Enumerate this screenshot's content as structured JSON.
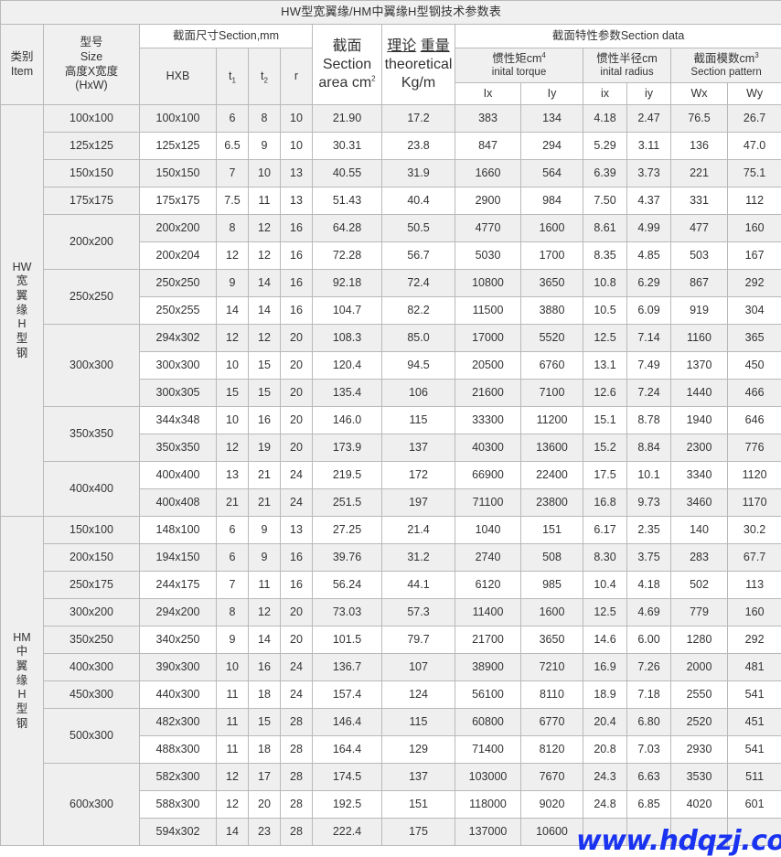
{
  "title": "HW型宽翼缘/HM中翼缘H型钢技术参数表",
  "watermark": "www.hdqzj.com",
  "colors": {
    "accent_red": "#ff0000",
    "watermark_blue": "#1a33f0",
    "header_bg": "#f0f0f0",
    "row_shade": "#efefef",
    "border": "#b9b9b9"
  },
  "header": {
    "category": {
      "cn": "类别",
      "en": "Item"
    },
    "size": {
      "l1": "型号",
      "l2": "Size",
      "l3": "高度X宽度",
      "l4": "(HxW)"
    },
    "section_dims": "截面尺寸Section,mm",
    "hxb": "HXB",
    "t1": "t",
    "t1_sub": "1",
    "t2": "t",
    "t2_sub": "2",
    "r": "r",
    "section_area": {
      "l1": "截面",
      "l2": "Section",
      "l3": "area",
      "l4": "cm",
      "sup": "2"
    },
    "theoretical_weight": {
      "l1": "理论",
      "l2": "重量",
      "l3": "theoretical",
      "l4": "Kg/m"
    },
    "section_data": "截面特性参数Section data",
    "inertia": {
      "cn": "惯性矩cm",
      "sup": "4",
      "en": "inital torque"
    },
    "radius": {
      "cn": "惯性半径cm",
      "en": "inital radius"
    },
    "modulus": {
      "cn": "截面模数cm",
      "sup": "3",
      "en": "Section pattern"
    },
    "Ix": "Ix",
    "Iy": "Iy",
    "ix": "ix",
    "iy": "iy",
    "Wx": "Wx",
    "Wy": "Wy"
  },
  "categories": [
    {
      "code": "HW",
      "label_chars": [
        "HW",
        "宽",
        "翼",
        "缘",
        "H",
        "型",
        "钢"
      ],
      "groups": [
        {
          "size": "100x100",
          "rows": [
            {
              "hxb": "100x100",
              "t1": "6",
              "t2": "8",
              "r": "10",
              "area": "21.90",
              "weight": "17.2",
              "Ix": "383",
              "Iy": "134",
              "ix": "4.18",
              "iy": "2.47",
              "Wx": "76.5",
              "Wy": "26.7"
            }
          ]
        },
        {
          "size": "125x125",
          "rows": [
            {
              "hxb": "125x125",
              "t1": "6.5",
              "t2": "9",
              "r": "10",
              "area": "30.31",
              "weight": "23.8",
              "Ix": "847",
              "Iy": "294",
              "ix": "5.29",
              "iy": "3.11",
              "Wx": "136",
              "Wy": "47.0"
            }
          ]
        },
        {
          "size": "150x150",
          "rows": [
            {
              "hxb": "150x150",
              "t1": "7",
              "t2": "10",
              "r": "13",
              "area": "40.55",
              "weight": "31.9",
              "Ix": "1660",
              "Iy": "564",
              "ix": "6.39",
              "iy": "3.73",
              "Wx": "221",
              "Wy": "75.1"
            }
          ]
        },
        {
          "size": "175x175",
          "rows": [
            {
              "hxb": "175x175",
              "t1": "7.5",
              "t2": "11",
              "r": "13",
              "area": "51.43",
              "weight": "40.4",
              "Ix": "2900",
              "Iy": "984",
              "ix": "7.50",
              "iy": "4.37",
              "Wx": "331",
              "Wy": "112"
            }
          ]
        },
        {
          "size": "200x200",
          "rows": [
            {
              "hxb": "200x200",
              "t1": "8",
              "t2": "12",
              "r": "16",
              "area": "64.28",
              "weight": "50.5",
              "Ix": "4770",
              "Iy": "1600",
              "ix": "8.61",
              "iy": "4.99",
              "Wx": "477",
              "Wy": "160"
            },
            {
              "hxb": "200x204",
              "t1": "12",
              "t2": "12",
              "r": "16",
              "area": "72.28",
              "weight": "56.7",
              "Ix": "5030",
              "Iy": "1700",
              "ix": "8.35",
              "iy": "4.85",
              "Wx": "503",
              "Wy": "167"
            }
          ]
        },
        {
          "size": "250x250",
          "rows": [
            {
              "hxb": "250x250",
              "t1": "9",
              "t2": "14",
              "r": "16",
              "area": "92.18",
              "weight": "72.4",
              "Ix": "10800",
              "Iy": "3650",
              "ix": "10.8",
              "iy": "6.29",
              "Wx": "867",
              "Wy": "292"
            },
            {
              "hxb": "250x255",
              "t1": "14",
              "t2": "14",
              "r": "16",
              "area": "104.7",
              "weight": "82.2",
              "Ix": "11500",
              "Iy": "3880",
              "ix": "10.5",
              "iy": "6.09",
              "Wx": "919",
              "Wy": "304"
            }
          ]
        },
        {
          "size": "300x300",
          "rows": [
            {
              "hxb": "294x302",
              "t1": "12",
              "t2": "12",
              "r": "20",
              "area": "108.3",
              "weight": "85.0",
              "Ix": "17000",
              "Iy": "5520",
              "ix": "12.5",
              "iy": "7.14",
              "Wx": "1160",
              "Wy": "365"
            },
            {
              "hxb": "300x300",
              "t1": "10",
              "t2": "15",
              "r": "20",
              "area": "120.4",
              "weight": "94.5",
              "Ix": "20500",
              "Iy": "6760",
              "ix": "13.1",
              "iy": "7.49",
              "Wx": "1370",
              "Wy": "450"
            },
            {
              "hxb": "300x305",
              "t1": "15",
              "t2": "15",
              "r": "20",
              "area": "135.4",
              "weight": "106",
              "Ix": "21600",
              "Iy": "7100",
              "ix": "12.6",
              "iy": "7.24",
              "Wx": "1440",
              "Wy": "466"
            }
          ]
        },
        {
          "size": "350x350",
          "rows": [
            {
              "hxb": "344x348",
              "t1": "10",
              "t2": "16",
              "r": "20",
              "area": "146.0",
              "weight": "115",
              "Ix": "33300",
              "Iy": "11200",
              "ix": "15.1",
              "iy": "8.78",
              "Wx": "1940",
              "Wy": "646"
            },
            {
              "hxb": "350x350",
              "t1": "12",
              "t2": "19",
              "r": "20",
              "area": "173.9",
              "weight": "137",
              "Ix": "40300",
              "Iy": "13600",
              "ix": "15.2",
              "iy": "8.84",
              "Wx": "2300",
              "Wy": "776"
            }
          ]
        },
        {
          "size": "400x400",
          "rows": [
            {
              "hxb": "400x400",
              "t1": "13",
              "t2": "21",
              "r": "24",
              "area": "219.5",
              "weight": "172",
              "Ix": "66900",
              "Iy": "22400",
              "ix": "17.5",
              "iy": "10.1",
              "Wx": "3340",
              "Wy": "1120"
            },
            {
              "hxb": "400x408",
              "t1": "21",
              "t2": "21",
              "r": "24",
              "area": "251.5",
              "weight": "197",
              "Ix": "71100",
              "Iy": "23800",
              "ix": "16.8",
              "iy": "9.73",
              "Wx": "3460",
              "Wy": "1170"
            }
          ]
        }
      ]
    },
    {
      "code": "HM",
      "label_chars": [
        "HM",
        "中",
        "翼",
        "缘",
        "H",
        "型",
        "钢"
      ],
      "groups": [
        {
          "size": "150x100",
          "rows": [
            {
              "hxb": "148x100",
              "t1": "6",
              "t2": "9",
              "r": "13",
              "area": "27.25",
              "weight": "21.4",
              "Ix": "1040",
              "Iy": "151",
              "ix": "6.17",
              "iy": "2.35",
              "Wx": "140",
              "Wy": "30.2"
            }
          ]
        },
        {
          "size": "200x150",
          "rows": [
            {
              "hxb": "194x150",
              "t1": "6",
              "t2": "9",
              "r": "16",
              "area": "39.76",
              "weight": "31.2",
              "Ix": "2740",
              "Iy": "508",
              "ix": "8.30",
              "iy": "3.75",
              "Wx": "283",
              "Wy": "67.7"
            }
          ]
        },
        {
          "size": "250x175",
          "rows": [
            {
              "hxb": "244x175",
              "t1": "7",
              "t2": "11",
              "r": "16",
              "area": "56.24",
              "weight": "44.1",
              "Ix": "6120",
              "Iy": "985",
              "ix": "10.4",
              "iy": "4.18",
              "Wx": "502",
              "Wy": "113"
            }
          ]
        },
        {
          "size": "300x200",
          "rows": [
            {
              "hxb": "294x200",
              "t1": "8",
              "t2": "12",
              "r": "20",
              "area": "73.03",
              "weight": "57.3",
              "Ix": "11400",
              "Iy": "1600",
              "ix": "12.5",
              "iy": "4.69",
              "Wx": "779",
              "Wy": "160"
            }
          ]
        },
        {
          "size": "350x250",
          "rows": [
            {
              "hxb": "340x250",
              "t1": "9",
              "t2": "14",
              "r": "20",
              "area": "101.5",
              "weight": "79.7",
              "Ix": "21700",
              "Iy": "3650",
              "ix": "14.6",
              "iy": "6.00",
              "Wx": "1280",
              "Wy": "292"
            }
          ]
        },
        {
          "size": "400x300",
          "rows": [
            {
              "hxb": "390x300",
              "t1": "10",
              "t2": "16",
              "r": "24",
              "area": "136.7",
              "weight": "107",
              "Ix": "38900",
              "Iy": "7210",
              "ix": "16.9",
              "iy": "7.26",
              "Wx": "2000",
              "Wy": "481"
            }
          ]
        },
        {
          "size": "450x300",
          "rows": [
            {
              "hxb": "440x300",
              "t1": "11",
              "t2": "18",
              "r": "24",
              "area": "157.4",
              "weight": "124",
              "Ix": "56100",
              "Iy": "8110",
              "ix": "18.9",
              "iy": "7.18",
              "Wx": "2550",
              "Wy": "541"
            }
          ]
        },
        {
          "size": "500x300",
          "rows": [
            {
              "hxb": "482x300",
              "t1": "11",
              "t2": "15",
              "r": "28",
              "area": "146.4",
              "weight": "115",
              "Ix": "60800",
              "Iy": "6770",
              "ix": "20.4",
              "iy": "6.80",
              "Wx": "2520",
              "Wy": "451"
            },
            {
              "hxb": "488x300",
              "t1": "11",
              "t2": "18",
              "r": "28",
              "area": "164.4",
              "weight": "129",
              "Ix": "71400",
              "Iy": "8120",
              "ix": "20.8",
              "iy": "7.03",
              "Wx": "2930",
              "Wy": "541"
            }
          ]
        },
        {
          "size": "600x300",
          "rows": [
            {
              "hxb": "582x300",
              "t1": "12",
              "t2": "17",
              "r": "28",
              "area": "174.5",
              "weight": "137",
              "Ix": "103000",
              "Iy": "7670",
              "ix": "24.3",
              "iy": "6.63",
              "Wx": "3530",
              "Wy": "511"
            },
            {
              "hxb": "588x300",
              "t1": "12",
              "t2": "20",
              "r": "28",
              "area": "192.5",
              "weight": "151",
              "Ix": "118000",
              "Iy": "9020",
              "ix": "24.8",
              "iy": "6.85",
              "Wx": "4020",
              "Wy": "601"
            },
            {
              "hxb": "594x302",
              "t1": "14",
              "t2": "23",
              "r": "28",
              "area": "222.4",
              "weight": "175",
              "Ix": "137000",
              "Iy": "10600",
              "ix": "",
              "iy": "",
              "Wx": "",
              "Wy": ""
            }
          ]
        }
      ]
    }
  ]
}
